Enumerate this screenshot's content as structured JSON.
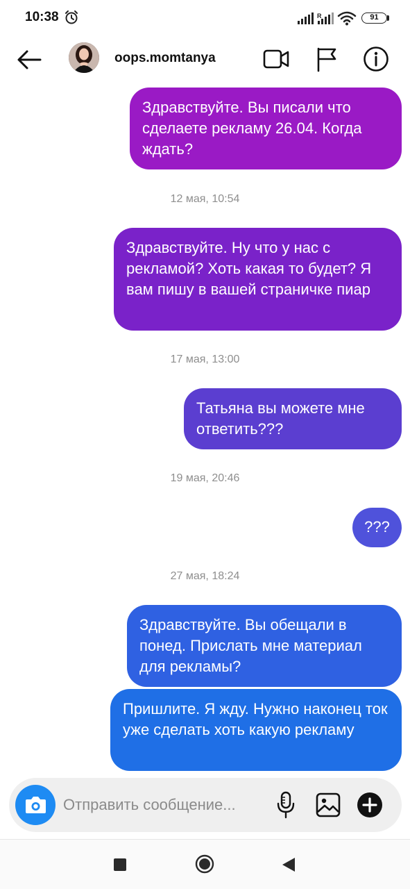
{
  "status_bar": {
    "time": "10:38",
    "battery": "91",
    "icons": [
      "alarm-icon",
      "signal-icon",
      "signal-r-icon",
      "wifi-icon",
      "battery-icon"
    ]
  },
  "header": {
    "username": "oops.momtanya",
    "icons": [
      "back-arrow-icon",
      "avatar",
      "video-camera-icon",
      "flag-icon",
      "info-icon"
    ]
  },
  "messages": [
    {
      "text": "Здравствуйте. Вы писали что сделаете рекламу 26.04. Когда ждать?",
      "color": "#9a1ac5"
    },
    {
      "timestamp": "12 мая, 10:54"
    },
    {
      "text": "Здравствуйте. Ну что у нас с рекламой? Хоть какая то будет? Я вам пишу в вашей страничке пиар",
      "color": "#7a22c9"
    },
    {
      "timestamp": "17 мая, 13:00"
    },
    {
      "text": "Татьяна вы можете мне ответить???",
      "color": "#5b3ed0"
    },
    {
      "timestamp": "19 мая, 20:46"
    },
    {
      "text": "???",
      "color": "#4f52db"
    },
    {
      "timestamp": "27 мая, 18:24"
    },
    {
      "text": "Здравствуйте. Вы обещали в понед. Прислать мне материал для рекламы?",
      "color": "#2f61e2"
    },
    {
      "text": "Пришлите. Я жду. Нужно наконец ток уже сделать хоть какую рекламу",
      "color": "#1f6fe6"
    }
  ],
  "composer": {
    "placeholder": "Отправить сообщение...",
    "value": "",
    "icons": [
      "camera-icon",
      "microphone-icon",
      "gallery-icon",
      "plus-icon"
    ],
    "camera_color": "#1e8bf3"
  },
  "nav_bar": {
    "icons": [
      "recents-square-icon",
      "home-circle-icon",
      "back-triangle-icon"
    ]
  }
}
